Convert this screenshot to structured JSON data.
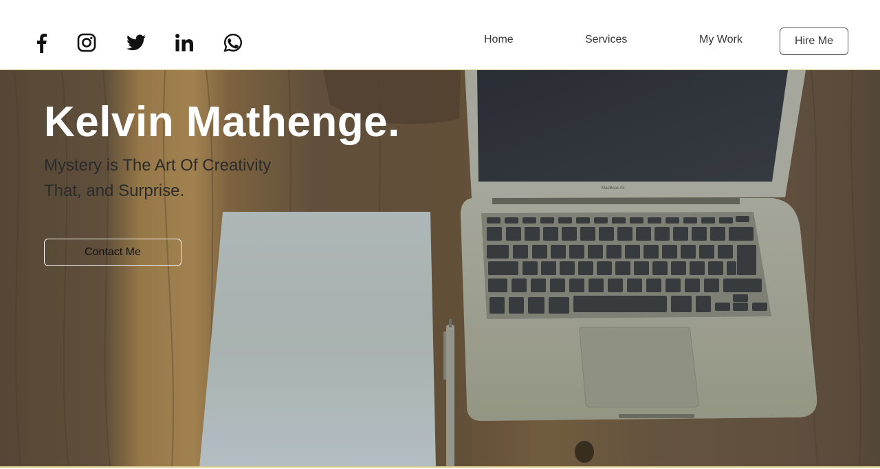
{
  "social": {
    "icons": [
      "facebook-icon",
      "instagram-icon",
      "twitter-icon",
      "linkedin-icon",
      "whatsapp-icon"
    ]
  },
  "nav": {
    "home": "Home",
    "services": "Services",
    "my_work": "My Work",
    "hire_me": "Hire Me"
  },
  "hero": {
    "name": "Kelvin Mathenge.",
    "tagline_line1": "Mystery is The Art Of Creativity",
    "tagline_line2": "That, and Surprise.",
    "contact_button": "Contact Me",
    "laptop_label": "MacBook Air"
  },
  "colors": {
    "header_bg": "#ffffff",
    "header_border": "#d9c98a",
    "title": "#ffffff",
    "tagline": "#2b2b2b",
    "wood_dark": "#5b4a38",
    "wood_light": "#a8844f"
  }
}
